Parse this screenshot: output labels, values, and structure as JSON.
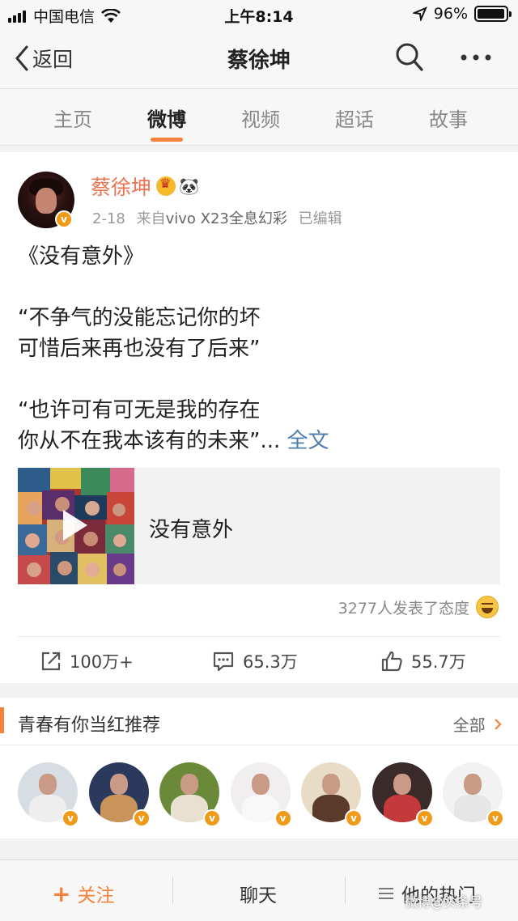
{
  "status_bar": {
    "carrier": "中国电信",
    "time": "上午8:14",
    "battery": "96%",
    "battery_level": 0.96
  },
  "nav": {
    "back_label": "返回",
    "title": "蔡徐坤"
  },
  "tabs": [
    {
      "label": "主页"
    },
    {
      "label": "微博"
    },
    {
      "label": "视频"
    },
    {
      "label": "超话"
    },
    {
      "label": "故事"
    }
  ],
  "active_tab": "微博",
  "post": {
    "author": "蔡徐坤",
    "date": "2-18",
    "source_prefix": "来自",
    "source": "vivo X23全息幻彩",
    "edited": "已编辑",
    "v_badge": "v",
    "lines": [
      "《没有意外》",
      "",
      "“不争气的没能忘记你的坏",
      "可惜后来再也没有了后来”",
      "",
      "“也许可有可无是我的存在",
      "你从不在我本该有的未来”..."
    ],
    "full_text_link": "全文",
    "media_title": "没有意外",
    "attitude_text": "3277人发表了态度",
    "reposts": "100万+",
    "comments": "65.3万",
    "likes": "55.7万"
  },
  "recommend": {
    "title": "青春有你当红推荐",
    "all_label": "全部",
    "avatars": [
      {
        "bg": "#d8dde3",
        "body": "#eeeeee"
      },
      {
        "bg": "#2b3a5c",
        "body": "#c8945a"
      },
      {
        "bg": "#6a8a3a",
        "body": "#e8e0d0"
      },
      {
        "bg": "#f0eeee",
        "body": "#f8f8f8"
      },
      {
        "bg": "#e8dcc6",
        "body": "#5a3a2a"
      },
      {
        "bg": "#3a2a2a",
        "body": "#c43a3a"
      },
      {
        "bg": "#f2f2f2",
        "body": "#e6e6e6"
      }
    ]
  },
  "bottom_bar": {
    "follow": "关注",
    "chat": "聊天",
    "hot": "他的热门",
    "watermark": "微博@头条号"
  },
  "colors": {
    "accent": "#f7813a",
    "author": "#eb7350",
    "link": "#4f7cae",
    "badge": "#f19a1a"
  }
}
